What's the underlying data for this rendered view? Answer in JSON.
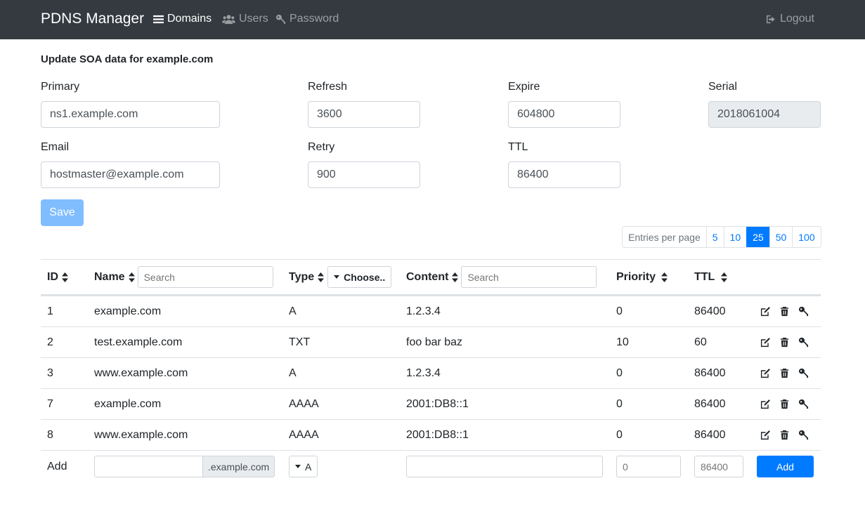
{
  "nav": {
    "brand": "PDNS Manager",
    "domains": "Domains",
    "users": "Users",
    "password": "Password",
    "logout": "Logout"
  },
  "soa": {
    "title": "Update SOA data for example.com",
    "primary_label": "Primary",
    "primary_value": "ns1.example.com",
    "email_label": "Email",
    "email_value": "hostmaster@example.com",
    "refresh_label": "Refresh",
    "refresh_value": "3600",
    "retry_label": "Retry",
    "retry_value": "900",
    "expire_label": "Expire",
    "expire_value": "604800",
    "ttl_label": "TTL",
    "ttl_value": "86400",
    "serial_label": "Serial",
    "serial_value": "2018061004",
    "save_label": "Save"
  },
  "pagination": {
    "label": "Entries per page",
    "options": [
      "5",
      "10",
      "25",
      "50",
      "100"
    ],
    "active": "25"
  },
  "table": {
    "headers": {
      "id": "ID",
      "name": "Name",
      "type": "Type",
      "content": "Content",
      "priority": "Priority",
      "ttl": "TTL"
    },
    "name_filter_placeholder": "Search",
    "type_filter_label": "Choose..",
    "content_filter_placeholder": "Search",
    "rows": [
      {
        "id": "1",
        "name": "example.com",
        "type": "A",
        "content": "1.2.3.4",
        "priority": "0",
        "ttl": "86400"
      },
      {
        "id": "2",
        "name": "test.example.com",
        "type": "TXT",
        "content": "foo bar baz",
        "priority": "10",
        "ttl": "60"
      },
      {
        "id": "3",
        "name": "www.example.com",
        "type": "A",
        "content": "1.2.3.4",
        "priority": "0",
        "ttl": "86400"
      },
      {
        "id": "7",
        "name": "example.com",
        "type": "AAAA",
        "content": "2001:DB8::1",
        "priority": "0",
        "ttl": "86400"
      },
      {
        "id": "8",
        "name": "www.example.com",
        "type": "AAAA",
        "content": "2001:DB8::1",
        "priority": "0",
        "ttl": "86400"
      }
    ],
    "add_row": {
      "label": "Add",
      "name_suffix": ".example.com",
      "type_value": "A",
      "priority_placeholder": "0",
      "ttl_placeholder": "86400",
      "add_button": "Add"
    }
  },
  "colors": {
    "navbar_bg": "#343a40",
    "primary": "#007bff",
    "save_disabled": "#80bdff"
  }
}
